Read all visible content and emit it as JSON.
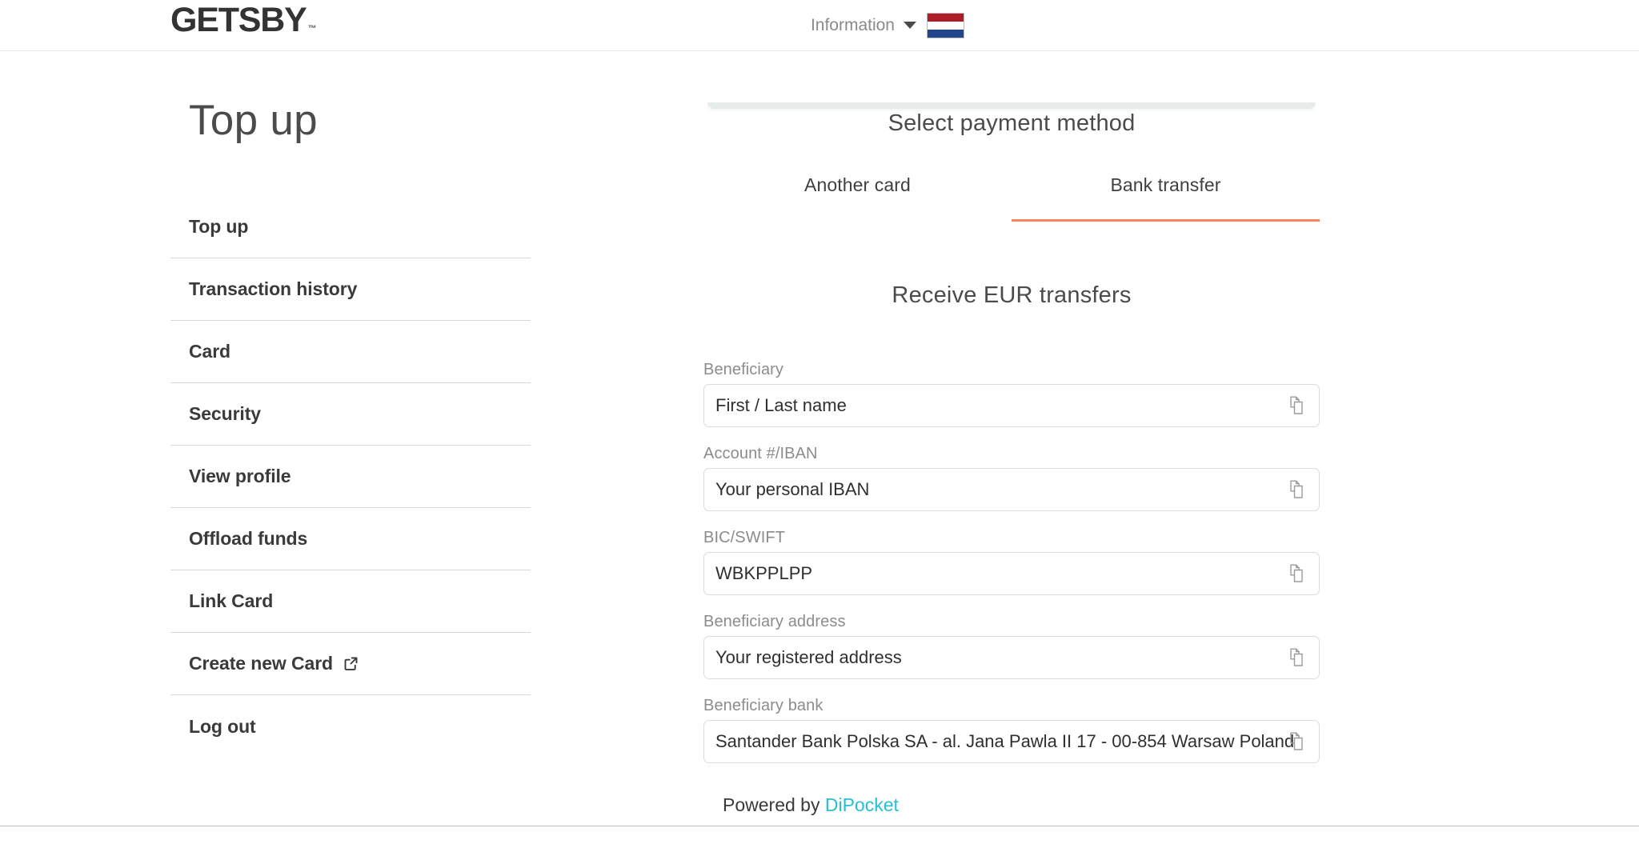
{
  "header": {
    "brand": "GETSBY",
    "brand_tm": "™",
    "information_label": "Information",
    "caret_icon": "chevron-down-icon",
    "flag_icon": "netherlands-flag-icon",
    "flag_colors": {
      "red": "#AE1C28",
      "white": "#FFFFFF",
      "blue": "#21468B"
    }
  },
  "sidebar": {
    "page_title": "Top up",
    "items": [
      {
        "label": "Top up",
        "icon": null
      },
      {
        "label": "Transaction history",
        "icon": null
      },
      {
        "label": "Card",
        "icon": null
      },
      {
        "label": "Security",
        "icon": null
      },
      {
        "label": "View profile",
        "icon": null
      },
      {
        "label": "Offload funds",
        "icon": null
      },
      {
        "label": "Link Card",
        "icon": null
      },
      {
        "label": "Create new Card",
        "icon": "external-link-icon"
      },
      {
        "label": "Log out",
        "icon": null
      }
    ]
  },
  "main": {
    "select_payment_method": "Select payment method",
    "tabs": [
      {
        "label": "Another card",
        "active": false
      },
      {
        "label": "Bank transfer",
        "active": true
      }
    ],
    "active_tab_color": "#F8845A",
    "form_title": "Receive EUR transfers",
    "fields": [
      {
        "label": "Beneficiary",
        "value": "First / Last name",
        "copy_icon": "copy-icon"
      },
      {
        "label": "Account #/IBAN",
        "value": "Your personal IBAN",
        "copy_icon": "copy-icon"
      },
      {
        "label": "BIC/SWIFT",
        "value": "WBKPPLPP",
        "copy_icon": "copy-icon"
      },
      {
        "label": "Beneficiary address",
        "value": "Your registered address",
        "copy_icon": "copy-icon"
      },
      {
        "label": "Beneficiary bank",
        "value": "Santander Bank Polska SA - al. Jana Pawla II 17 - 00-854 Warsaw Poland",
        "copy_icon": "copy-icon"
      }
    ]
  },
  "footer": {
    "powered_by": "Powered by ",
    "provider": "DiPocket",
    "provider_color": "#25C0D5"
  }
}
